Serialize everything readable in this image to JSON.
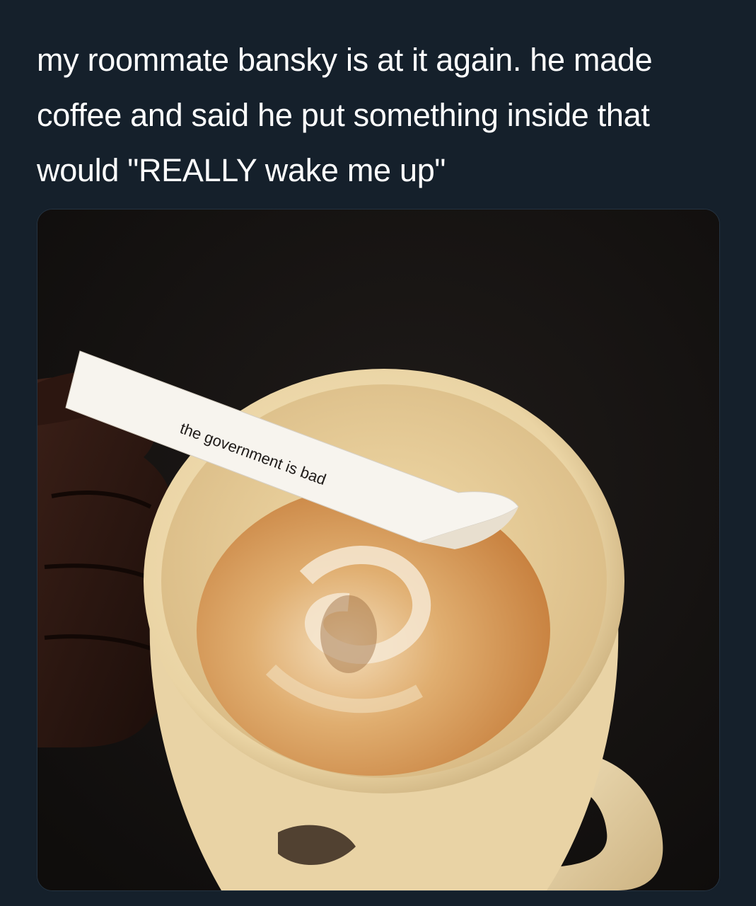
{
  "tweet": {
    "text": "my roommate bansky is at it again. he made coffee and said he put something inside that would \"REALLY wake me up\""
  },
  "media": {
    "fortune_text": "the government is bad",
    "icons": [
      "coffee-mug",
      "fortune-paper-slip",
      "hand"
    ]
  },
  "colors": {
    "background": "#15202b",
    "text": "#ffffff",
    "mug": "#efdcb0",
    "coffee_foam": "#d9a96a"
  }
}
